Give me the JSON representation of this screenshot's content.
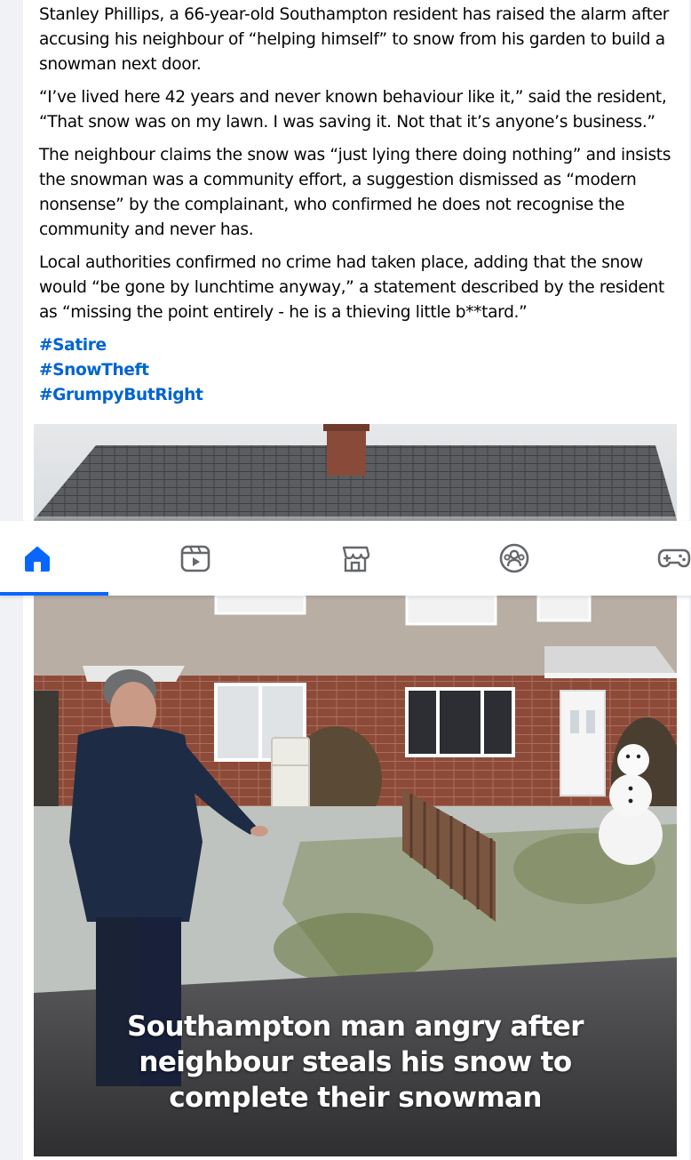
{
  "post": {
    "paragraphs": [
      "Stanley Phillips, a 66-year-old Southampton resident has raised the alarm after accusing his neighbour of “helping himself” to snow from his garden to build a snowman next door.",
      "“I’ve lived here 42 years and never known behaviour like it,” said the resident, “That snow was on my lawn. I was saving it. Not that it’s anyone’s business.”",
      "The neighbour claims the snow was “just lying there doing nothing” and insists the snowman was a community effort, a suggestion dismissed as “modern nonsense” by the complainant, who confirmed he does not recognise the community and never has.",
      "Local authorities confirmed no crime had taken place, adding that the snow would “be gone by lunchtime anyway,” a statement described by the resident as “missing the point entirely - he is a thieving little b**tard.”"
    ],
    "hashtags": [
      "#Satire",
      "#SnowTheft",
      "#GrumpyButRight"
    ]
  },
  "photo": {
    "caption_lines": [
      "Southampton man angry after",
      "neighbour steals his snow to",
      "complete their snowman"
    ]
  },
  "navbar": {
    "items": [
      {
        "icon": "home-icon",
        "active": true
      },
      {
        "icon": "video-icon",
        "active": false
      },
      {
        "icon": "marketplace-icon",
        "active": false
      },
      {
        "icon": "groups-icon",
        "active": false
      },
      {
        "icon": "gaming-icon",
        "active": false
      }
    ],
    "accent_color": "#0866ff",
    "icon_color": "#65676b"
  }
}
